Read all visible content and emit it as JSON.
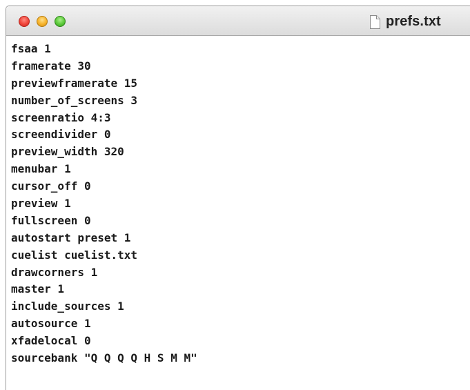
{
  "window": {
    "title": "prefs.txt",
    "title_icon": "text-document-icon",
    "controls": [
      "close",
      "minimize",
      "zoom"
    ],
    "colors": {
      "close": "#f0453a",
      "minimize": "#f6b22a",
      "zoom": "#5cc93a"
    }
  },
  "editor": {
    "lines": [
      "fsaa 1",
      "framerate 30",
      "previewframerate 15",
      "number_of_screens 3",
      "screenratio 4:3",
      "screendivider 0",
      "preview_width 320",
      "menubar 1",
      "cursor_off 0",
      "preview 1",
      "fullscreen 0",
      "autostart preset 1",
      "cuelist cuelist.txt",
      "drawcorners 1",
      "master 1",
      "include_sources 1",
      "autosource 1",
      "xfadelocal 0",
      "sourcebank \"Q Q Q Q H S M M\""
    ]
  }
}
